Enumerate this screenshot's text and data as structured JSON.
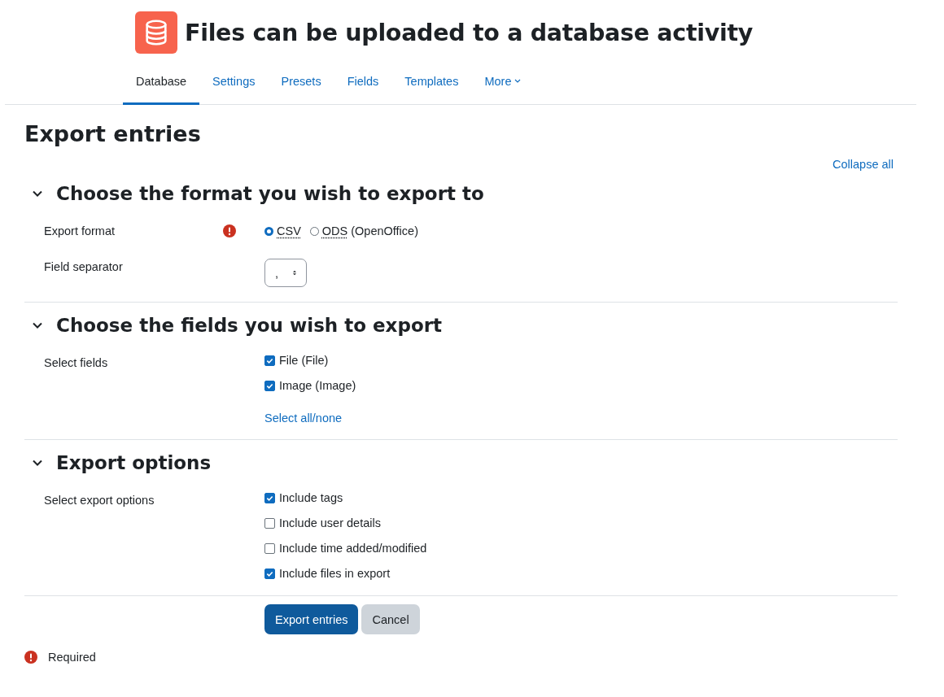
{
  "page_title": "Files can be uploaded to a database activity",
  "tabs": [
    {
      "label": "Database",
      "selected": true
    },
    {
      "label": "Settings",
      "selected": false
    },
    {
      "label": "Presets",
      "selected": false
    },
    {
      "label": "Fields",
      "selected": false
    },
    {
      "label": "Templates",
      "selected": false
    },
    {
      "label": "More",
      "selected": false,
      "kind": "dropdown"
    }
  ],
  "heading": "Export entries",
  "collapse_link": "Collapse all",
  "sections": [
    {
      "title": "Choose the format you wish to export to",
      "expanded": true,
      "rows": [
        {
          "label": "Export format",
          "required": true,
          "kind": "radio",
          "options": [
            {
              "abbr": "CSV",
              "selected": true
            },
            {
              "abbr": "ODS",
              "note": "(OpenOffice)",
              "selected": false
            }
          ]
        },
        {
          "label": "Field separator",
          "required": false,
          "kind": "select",
          "value": ","
        }
      ]
    },
    {
      "title": "Choose the fields you wish to export",
      "expanded": true,
      "rows": [
        {
          "label": "Select fields",
          "required": false,
          "kind": "checkboxes",
          "options": [
            {
              "label": "File (File)",
              "checked": true
            },
            {
              "label": "Image (Image)",
              "checked": true
            }
          ],
          "link": "Select all/none"
        }
      ]
    },
    {
      "title": "Export options",
      "expanded": true,
      "rows": [
        {
          "label": "Select export options",
          "required": false,
          "kind": "checkboxes",
          "options": [
            {
              "label": "Include tags",
              "checked": true
            },
            {
              "label": "Include user details",
              "checked": false
            },
            {
              "label": "Include time added/modified",
              "checked": false
            },
            {
              "label": "Include files in export",
              "checked": true
            }
          ]
        }
      ]
    }
  ],
  "buttons": [
    {
      "label": "Export entries",
      "kind": "primary"
    },
    {
      "label": "Cancel",
      "kind": "secondary"
    }
  ],
  "required_note": "Required"
}
